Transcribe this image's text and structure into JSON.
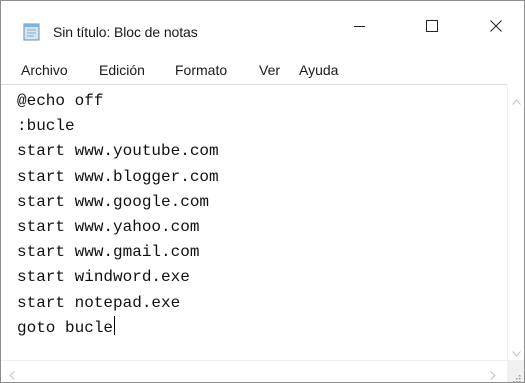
{
  "window": {
    "title": "Sin título: Bloc de notas",
    "icon": "notepad-icon"
  },
  "controls": {
    "minimize_icon": "minimize-icon",
    "maximize_icon": "maximize-icon",
    "close_icon": "close-icon"
  },
  "menu": {
    "items": [
      {
        "label": "Archivo"
      },
      {
        "label": "Edición"
      },
      {
        "label": "Formato"
      },
      {
        "label": "Ver"
      },
      {
        "label": "Ayuda"
      }
    ]
  },
  "editor": {
    "lines": [
      "@echo off",
      ":bucle",
      "start www.youtube.com",
      "start www.blogger.com",
      "start www.google.com",
      "start www.yahoo.com",
      "start www.gmail.com",
      "start windword.exe",
      "start notepad.exe",
      "goto bucle"
    ]
  },
  "scrollbars": {
    "up_icon": "scroll-up-icon",
    "down_icon": "scroll-down-icon",
    "left_icon": "scroll-left-icon",
    "right_icon": "scroll-right-icon",
    "grip_icon": "size-grip-icon"
  }
}
